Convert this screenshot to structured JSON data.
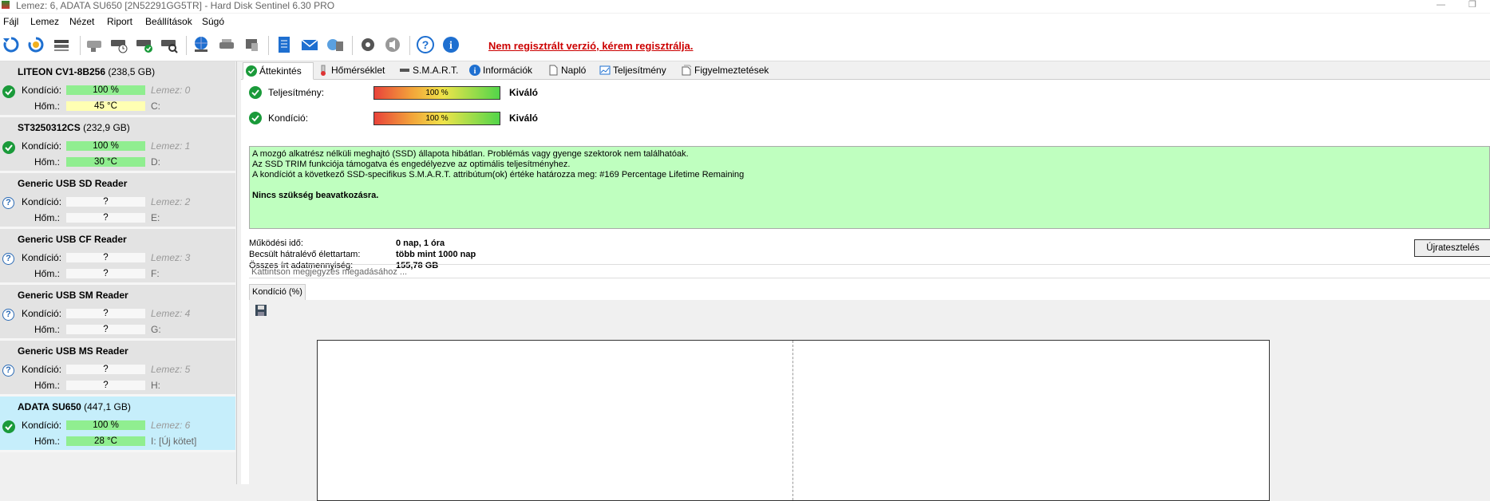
{
  "titlebar": {
    "title": "Lemez: 6, ADATA SU650 [2N52291GG5TR]  -  Hard Disk Sentinel 6.30 PRO"
  },
  "menu": [
    {
      "label": "Fájl"
    },
    {
      "label": "Lemez"
    },
    {
      "label": "Nézet"
    },
    {
      "label": "Riport"
    },
    {
      "label": "Beállítások"
    },
    {
      "label": "Súgó"
    }
  ],
  "toolbar": {
    "reg_notice": "Nem regisztrált verzió, kérem regisztrálja."
  },
  "disks": [
    {
      "name": "LITEON CV1-8B256",
      "size": "(238,5 GB)",
      "status": "ok",
      "kondicio_label": "Kondíció:",
      "kondicio": "100 %",
      "hom_label": "Hőm.:",
      "hom": "45 °C",
      "lemez": "Lemez: 0",
      "drive": "C:"
    },
    {
      "name": "ST3250312CS",
      "size": "(232,9 GB)",
      "status": "ok",
      "kondicio_label": "Kondíció:",
      "kondicio": "100 %",
      "hom_label": "Hőm.:",
      "hom": "30 °C",
      "lemez": "Lemez: 1",
      "drive": "D:"
    },
    {
      "name": "Generic USB SD Reader",
      "size": "",
      "status": "unknown",
      "kondicio_label": "Kondíció:",
      "kondicio": "?",
      "hom_label": "Hőm.:",
      "hom": "?",
      "lemez": "Lemez: 2",
      "drive": "E:"
    },
    {
      "name": "Generic USB CF Reader",
      "size": "",
      "status": "unknown",
      "kondicio_label": "Kondíció:",
      "kondicio": "?",
      "hom_label": "Hőm.:",
      "hom": "?",
      "lemez": "Lemez: 3",
      "drive": "F:"
    },
    {
      "name": "Generic USB SM Reader",
      "size": "",
      "status": "unknown",
      "kondicio_label": "Kondíció:",
      "kondicio": "?",
      "hom_label": "Hőm.:",
      "hom": "?",
      "lemez": "Lemez: 4",
      "drive": "G:"
    },
    {
      "name": "Generic USB MS Reader",
      "size": "",
      "status": "unknown",
      "kondicio_label": "Kondíció:",
      "kondicio": "?",
      "hom_label": "Hőm.:",
      "hom": "?",
      "lemez": "Lemez: 5",
      "drive": "H:"
    },
    {
      "name": "ADATA SU650",
      "size": "(447,1 GB)",
      "status": "ok",
      "kondicio_label": "Kondíció:",
      "kondicio": "100 %",
      "hom_label": "Hőm.:",
      "hom": "28 °C",
      "lemez": "Lemez: 6",
      "drive": "I: [Új kötet]"
    }
  ],
  "tabs": [
    {
      "label": "Áttekintés"
    },
    {
      "label": "Hőmérséklet"
    },
    {
      "label": "S.M.A.R.T."
    },
    {
      "label": "Információk"
    },
    {
      "label": "Napló"
    },
    {
      "label": "Teljesítmény"
    },
    {
      "label": "Figyelmeztetések"
    }
  ],
  "overview": {
    "performance_label": "Teljesítmény:",
    "performance_value": "100 %",
    "performance_percent": 100,
    "performance_rating": "Kiváló",
    "condition_label": "Kondíció:",
    "condition_value": "100 %",
    "condition_percent": 100,
    "condition_rating": "Kiváló",
    "info_lines": [
      "A mozgó alkatrész nélküli meghajtó (SSD) állapota hibátlan. Problémás vagy gyenge szektorok nem találhatóak.",
      "Az SSD TRIM funkciója támogatva és engedélyezve az optimális teljesítményhez.",
      "A kondíciót a következő SSD-specifikus S.M.A.R.T. attribútum(ok) értéke határozza meg:  #169 Percentage Lifetime Remaining"
    ],
    "info_action": "Nincs szükség beavatkozásra.",
    "uptime_label": "Működési idő:",
    "uptime_value": "0 nap, 1 óra",
    "lifetime_label": "Becsült hátralévő élettartam:",
    "lifetime_value": "több mint 1000 nap",
    "written_label": "Összes írt adatmennyiség:",
    "written_value": "155,78 GB",
    "retest_button": "Újratesztelés",
    "note_placeholder": "Kattintson megjegyzés megadásához ...",
    "chart_tab": "Kondíció  (%)"
  },
  "colors": {
    "ok_green": "#1a9a3a",
    "info_bg": "#bfffbf",
    "selected_disk": "#c6eefb",
    "reg_red": "#cc0000"
  }
}
